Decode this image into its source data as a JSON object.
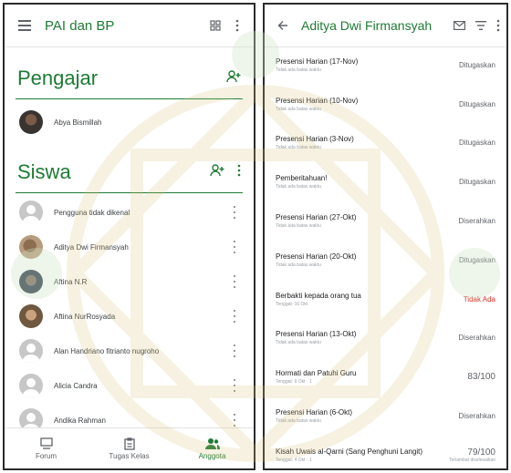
{
  "left": {
    "title": "PAI dan BP",
    "teachers_heading": "Pengajar",
    "teachers": [
      "Abya Bismillah"
    ],
    "students_heading": "Siswa",
    "students": [
      {
        "name": "Pengguna tidak dikenal",
        "avatar": "blank"
      },
      {
        "name": "Aditya Dwi Firmansyah",
        "avatar": "photo2"
      },
      {
        "name": "Aftina N.R",
        "avatar": "photo3"
      },
      {
        "name": "Aftina NurRosyada",
        "avatar": "photo4"
      },
      {
        "name": "Alan Handriano fitrianto nugroho",
        "avatar": "blank"
      },
      {
        "name": "Alicia Candra",
        "avatar": "blank"
      },
      {
        "name": "Andika Rahman",
        "avatar": "blank"
      }
    ],
    "nav": {
      "forum": "Forum",
      "classwork": "Tugas Kelas",
      "members": "Anggota"
    }
  },
  "right": {
    "title": "Aditya Dwi Firmansyah",
    "items": [
      {
        "title": "Presensi Harian (17-Nov)",
        "sub": "Tidak ada batas waktu",
        "status": "Ditugaskan",
        "type": "normal"
      },
      {
        "title": "Presensi Harian (10-Nov)",
        "sub": "Tidak ada batas waktu",
        "status": "Ditugaskan",
        "type": "normal"
      },
      {
        "title": "Presensi Harian (3-Nov)",
        "sub": "Tidak ada batas waktu",
        "status": "Ditugaskan",
        "type": "normal"
      },
      {
        "title": "Pemberitahuan!",
        "sub": "Tidak ada batas waktu",
        "status": "Ditugaskan",
        "type": "normal"
      },
      {
        "title": "Presensi Harian (27-Okt)",
        "sub": "Tidak ada batas waktu",
        "status": "Diserahkan",
        "type": "normal"
      },
      {
        "title": "Presensi Harian (20-Okt)",
        "sub": "Tidak ada batas waktu",
        "status": "Ditugaskan",
        "type": "normal"
      },
      {
        "title": "Berbakti kepada orang tua",
        "sub": "Tenggat: 16 Okt",
        "status": "Tidak Ada",
        "type": "late"
      },
      {
        "title": "Presensi Harian (13-Okt)",
        "sub": "Tidak ada batas waktu",
        "status": "Diserahkan",
        "type": "normal"
      },
      {
        "title": "Hormati dan Patuhi Guru",
        "sub": "Tenggat: 9 Okt · 1",
        "status": "83/100",
        "type": "score"
      },
      {
        "title": "Presensi Harian (6-Okt)",
        "sub": "Tidak ada batas waktu",
        "status": "Diserahkan",
        "type": "normal"
      },
      {
        "title": "Kisah Uwais al-Qarni (Sang Penghuni Langit)",
        "sub": "Tenggat: 4 Okt · 1",
        "status": "79/100",
        "status_note": "Terlambat diselesaikan",
        "type": "score"
      }
    ]
  },
  "colors": {
    "accent": "#1e7b34",
    "late": "#d93025"
  }
}
